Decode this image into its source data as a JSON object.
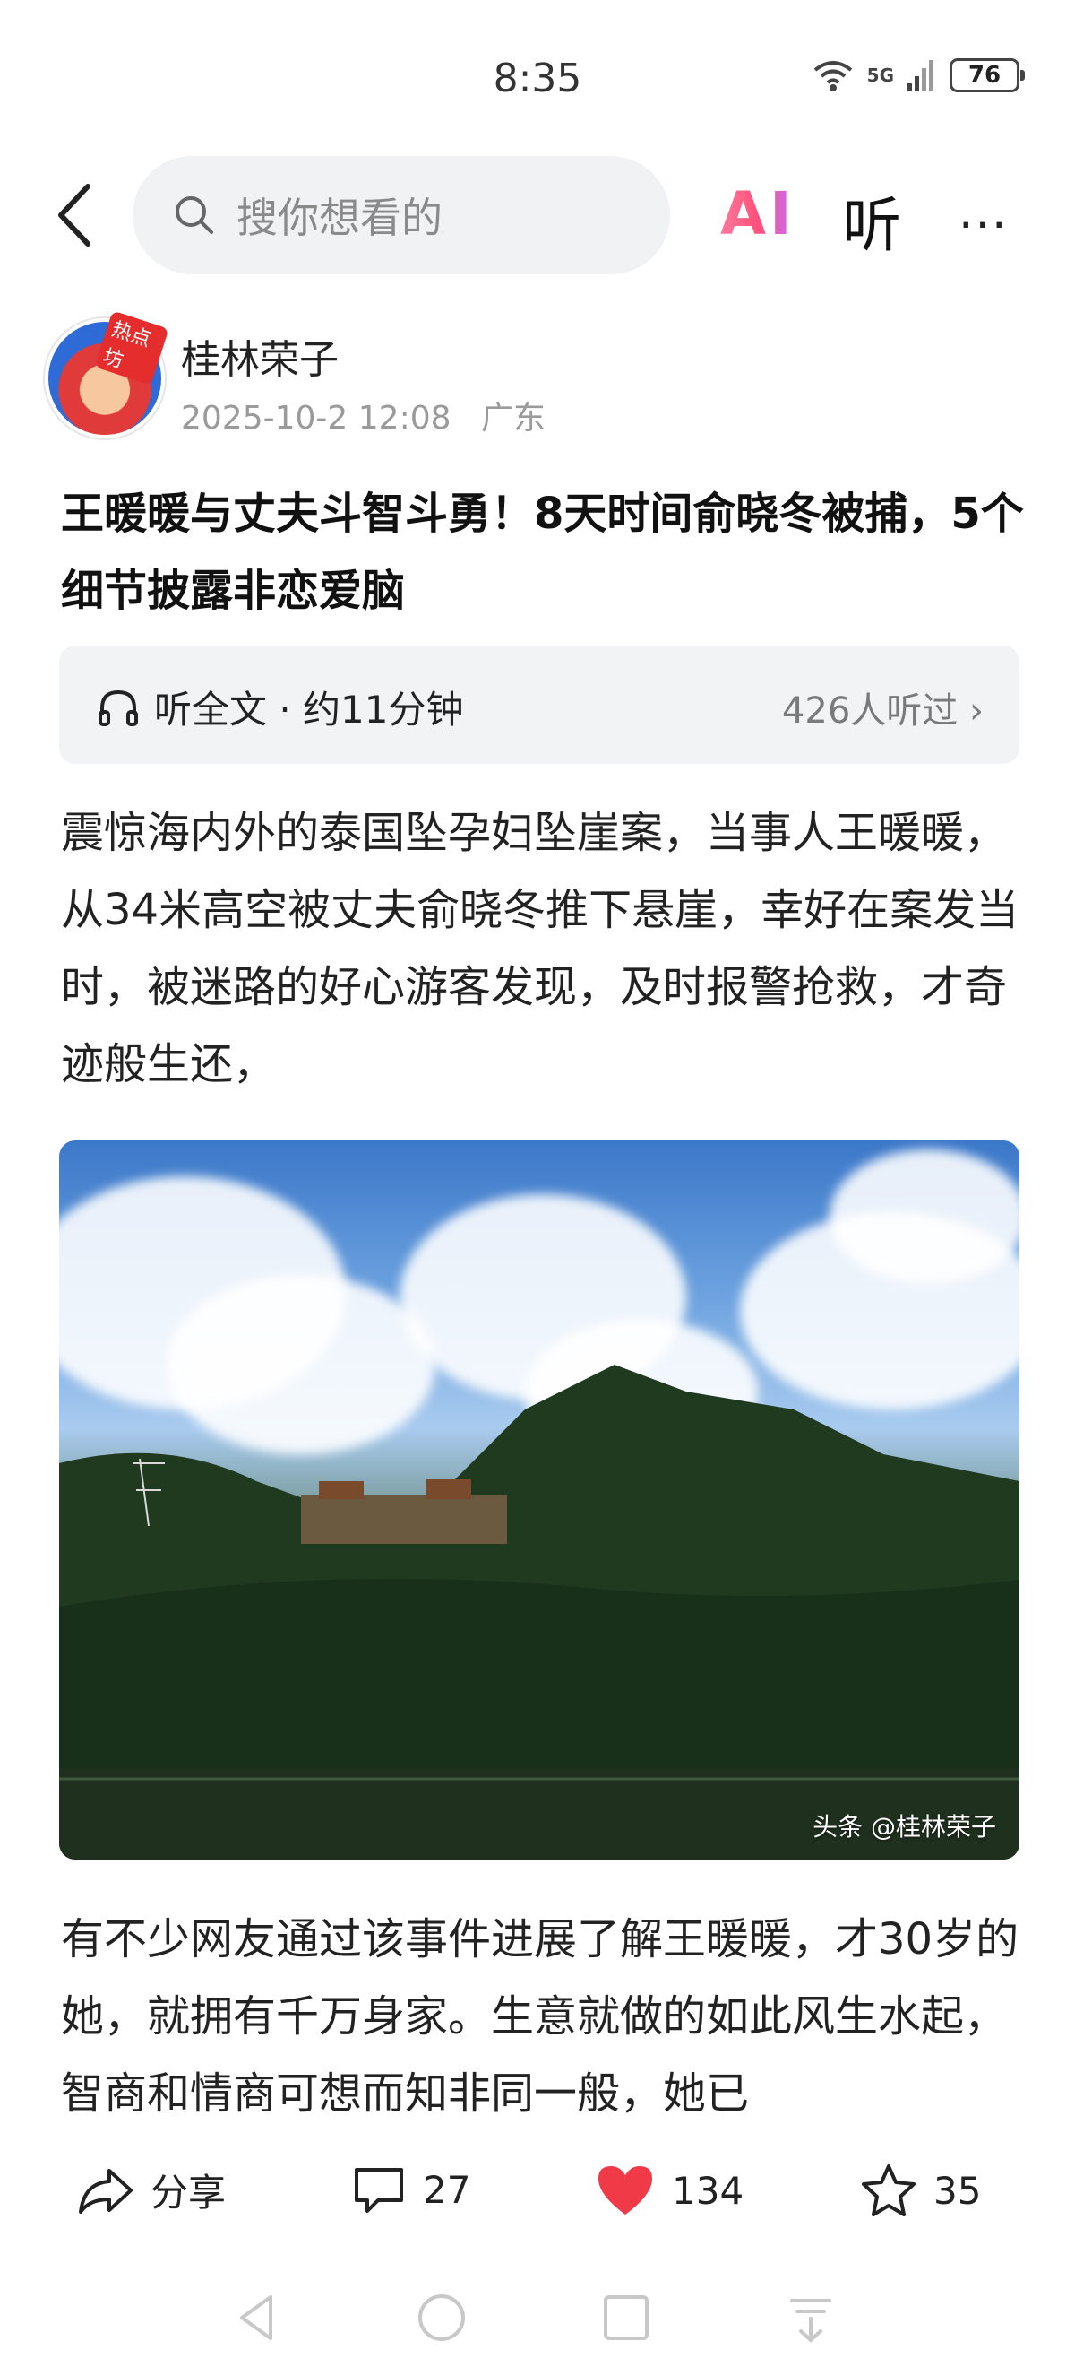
{
  "status_bar": {
    "time": "8:35",
    "network": "5G",
    "battery": "76"
  },
  "top_bar": {
    "search_placeholder": "搜你想看的",
    "ai_label": "AI",
    "listen_label": "听",
    "more_label": "···"
  },
  "author": {
    "name": "桂林荣子",
    "datetime": "2025-10-2  12:08",
    "location": "广东",
    "avatar_badge": "热点坊"
  },
  "article": {
    "title": "王暖暖与丈夫斗智斗勇！8天时间俞晓冬被捕，5个细节披露非恋爱脑",
    "listen_full": "听全文 · 约11分钟",
    "listeners": "426人听过 ›",
    "paragraph1": "震惊海内外的泰国坠孕妇坠崖案，当事人王暖暖，从34米高空被丈夫俞晓冬推下悬崖，幸好在案发当时，被迷路的好心游客发现，及时报警抢救，才奇迹般生还，",
    "image_watermark": "头条 @桂林荣子",
    "paragraph2": "有不少网友通过该事件进展了解王暖暖，才30岁的她，就拥有千万身家。生意就做的如此风生水起，智商和情商可想而知非同一般，她已"
  },
  "actions": {
    "share_label": "分享",
    "comment_count": "27",
    "like_count": "134",
    "favorite_count": "35",
    "like_color": "#f03a47"
  }
}
